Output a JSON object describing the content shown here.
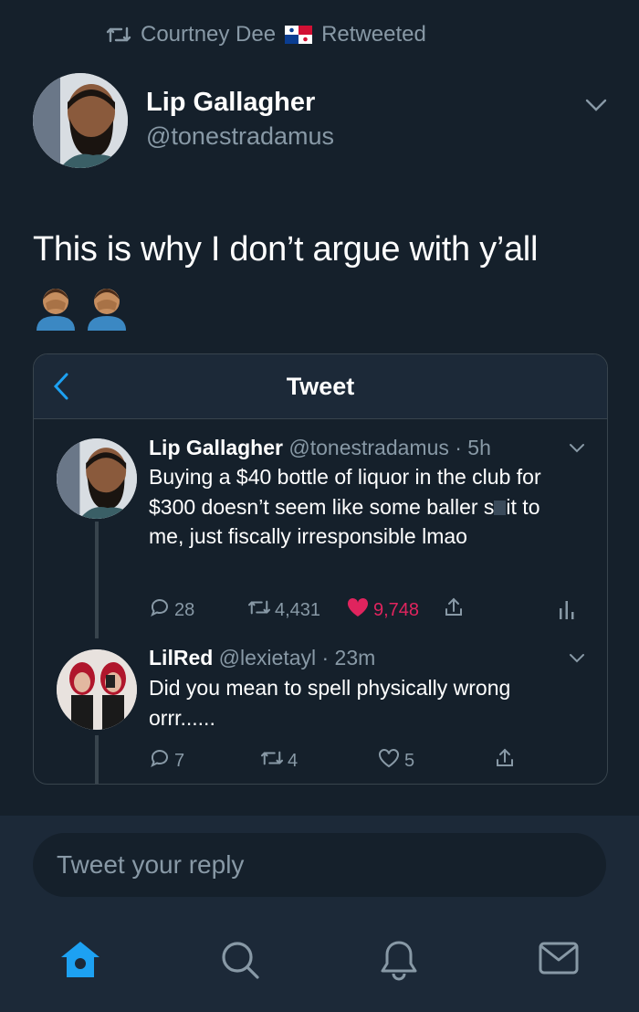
{
  "retweet": {
    "user": "Courtney Dee",
    "label": "Retweeted"
  },
  "tweet": {
    "author_name": "Lip Gallagher",
    "author_handle": "@tonestradamus",
    "text": "This is why I don’t argue with y’all"
  },
  "card": {
    "title": "Tweet",
    "tweets": [
      {
        "name": "Lip Gallagher",
        "meta": "@tonestradamus · 5h",
        "text_before": "Buying a $40 bottle of liquor in the club for $300 doesn’t seem like some baller s",
        "text_after": "it to me, just fiscally irresponsible lmao",
        "replies": "28",
        "retweets": "4,431",
        "likes": "9,748",
        "liked": true
      },
      {
        "name": "LilRed",
        "meta": "@lexietayl · 23m",
        "text": "Did you mean to spell physically wrong orrr......",
        "replies": "7",
        "retweets": "4",
        "likes": "5",
        "liked": false
      }
    ]
  },
  "reply": {
    "placeholder": "Tweet your reply"
  },
  "colors": {
    "background": "#15202b",
    "accent": "#1da1f2",
    "like": "#e0245e",
    "muted": "#8899a6"
  }
}
